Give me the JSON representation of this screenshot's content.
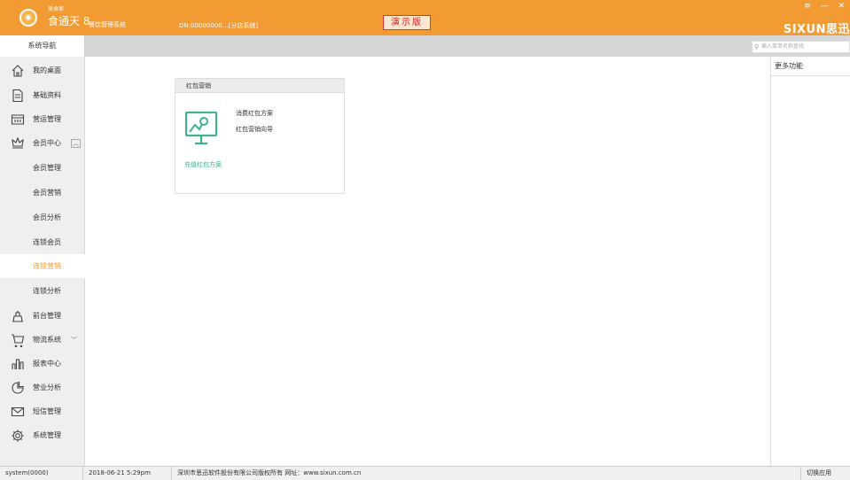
{
  "titlebar": {
    "brand_small": "美食家",
    "brand_name": "食通天 8",
    "brand_sub": "餐饮管理系统",
    "dn": "DN:00000000…[分店系统]",
    "demo_badge": "演示版",
    "window_controls": "≡ — ✕",
    "logo": "SIXUN思迅",
    "bg_color": "#f39b33"
  },
  "subbar": {
    "nav_tab": "系统导航",
    "search_placeholder": "输入菜单名称查找"
  },
  "sidebar": {
    "items": [
      {
        "label": "我的桌面",
        "icon": "home-icon"
      },
      {
        "label": "基础资料",
        "icon": "document-icon"
      },
      {
        "label": "营运管理",
        "icon": "calendar-icon"
      },
      {
        "label": "会员中心",
        "icon": "crown-icon",
        "expanded": true
      },
      {
        "label": "会员管理"
      },
      {
        "label": "会员营销"
      },
      {
        "label": "会员分析"
      },
      {
        "label": "连锁会员"
      },
      {
        "label": "连锁营销",
        "active": true
      },
      {
        "label": "连锁分析"
      },
      {
        "label": "前台管理",
        "icon": "cashier-icon"
      },
      {
        "label": "物流系统",
        "icon": "cart-icon",
        "collapsed": true
      },
      {
        "label": "报表中心",
        "icon": "bar-chart-icon"
      },
      {
        "label": "营业分析",
        "icon": "pie-chart-icon"
      },
      {
        "label": "短信管理",
        "icon": "mail-icon"
      },
      {
        "label": "系统管理",
        "icon": "gear-icon"
      }
    ],
    "active_color": "#f39b33"
  },
  "card": {
    "title": "红包营销",
    "link1": "消费红包方案",
    "link2": "红包营销向导",
    "footer": "充值红包方案",
    "icon": "presentation-icon",
    "accent": "#3fb28b"
  },
  "rightpanel": {
    "title": "更多功能"
  },
  "statusbar": {
    "user": "system(0000)",
    "datetime": "2018-06-21 5:29pm",
    "copyright": "深圳市思迅软件股份有限公司版权所有 网址：www.sixun.com.cn",
    "switch": "切换应用"
  }
}
